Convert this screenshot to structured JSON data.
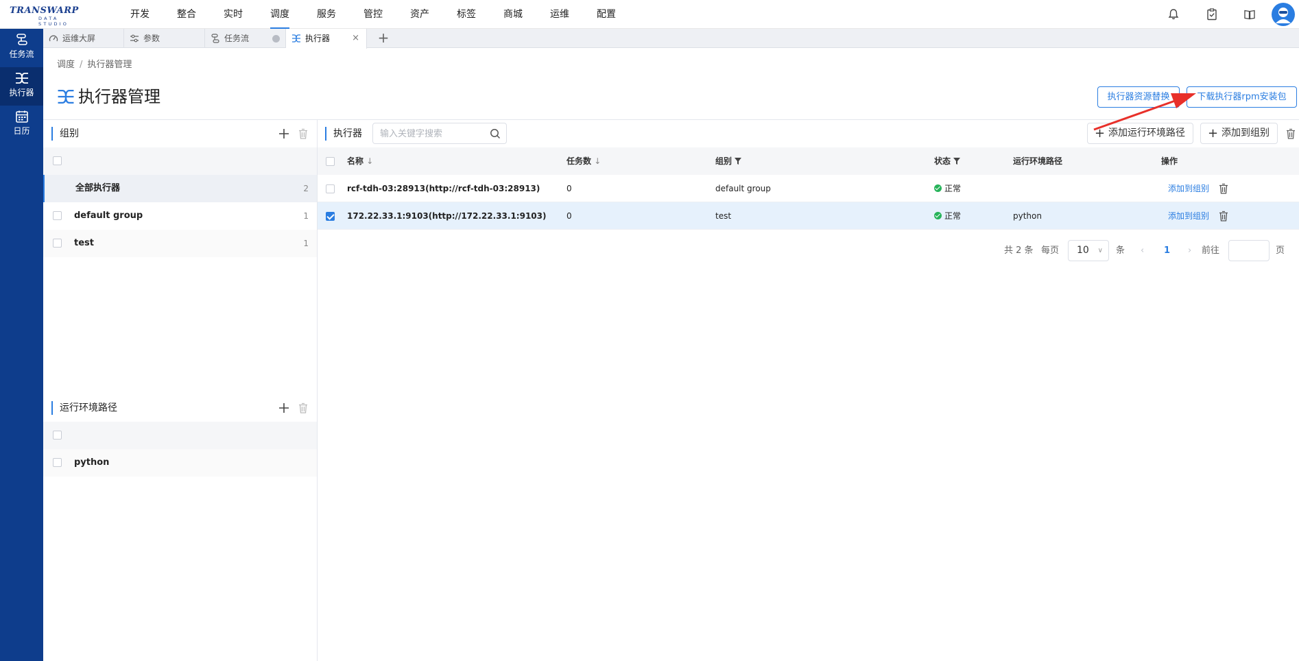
{
  "brand": {
    "logo_line1": "TRANSWARP",
    "logo_line2": "DATA STUDIO"
  },
  "nav": [
    "开发",
    "整合",
    "实时",
    "调度",
    "服务",
    "管控",
    "资产",
    "标签",
    "商城",
    "运维",
    "配置"
  ],
  "nav_active": "调度",
  "top_icons": [
    "bell-icon",
    "clipboard-check-icon",
    "book-icon",
    "avatar"
  ],
  "sidebar": [
    {
      "label": "任务流",
      "icon": "workflow-icon"
    },
    {
      "label": "执行器",
      "icon": "executor-icon",
      "active": true
    },
    {
      "label": "日历",
      "icon": "calendar-icon"
    }
  ],
  "tabs": [
    {
      "label": "运维大屏",
      "icon": "gauge-icon"
    },
    {
      "label": "参数",
      "icon": "sliders-icon"
    },
    {
      "label": "任务流",
      "icon": "workflow-icon"
    },
    {
      "label": "执行器",
      "icon": "executor-icon",
      "active": true
    }
  ],
  "breadcrumb": {
    "parent": "调度",
    "separator": "/",
    "current": "执行器管理"
  },
  "page_title": "执行器管理",
  "buttons": {
    "replace_resource": "执行器资源替换",
    "download_rpm": "下载执行器rpm安装包",
    "add_env_path": "添加运行环境路径",
    "add_to_group": "添加到组别"
  },
  "group_panel": {
    "title": "组别",
    "items": [
      {
        "name": "全部执行器",
        "count": "2",
        "active": true
      },
      {
        "name": "default group",
        "count": "1"
      },
      {
        "name": "test",
        "count": "1"
      }
    ]
  },
  "env_panel": {
    "title": "运行环境路径",
    "items": [
      {
        "name": "python"
      }
    ]
  },
  "executor_panel": {
    "title": "执行器",
    "search_placeholder": "输入关键字搜索"
  },
  "table": {
    "columns": [
      "名称",
      "任务数",
      "组别",
      "状态",
      "运行环境路径",
      "操作"
    ],
    "rows": [
      {
        "name": "rcf-tdh-03:28913(http://rcf-tdh-03:28913)",
        "tasks": "0",
        "group": "default group",
        "status": "正常",
        "env": "",
        "action": "添加到组别",
        "checked": false
      },
      {
        "name": "172.22.33.1:9103(http://172.22.33.1:9103)",
        "tasks": "0",
        "group": "test",
        "status": "正常",
        "env": "python",
        "action": "添加到组别",
        "checked": true
      }
    ]
  },
  "pagination": {
    "total_text": "共 2 条",
    "per_page_label": "每页",
    "page_size": "10",
    "unit": "条",
    "current_page": "1",
    "goto_label": "前往",
    "page_unit": "页"
  },
  "colors": {
    "primary": "#2a7de1",
    "sidebar": "#0e3d8c",
    "success": "#27b35a",
    "annotation_arrow": "#e8302a"
  }
}
